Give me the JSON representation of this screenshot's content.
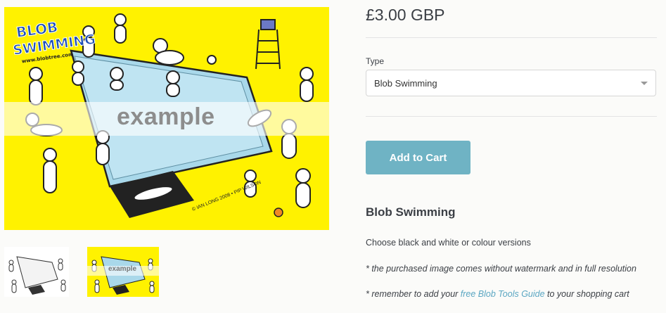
{
  "product": {
    "price": "£3.00 GBP",
    "type_label": "Type",
    "type_selected": "Blob Swimming",
    "add_to_cart": "Add to Cart",
    "title": "Blob Swimming",
    "description_1": "Choose black and white or colour versions",
    "description_2": "* the purchased image comes without watermark and in full resolution",
    "description_3_prefix": "* remember to add your ",
    "description_3_link": "free Blob Tools Guide",
    "description_3_suffix": " to your shopping cart"
  },
  "image": {
    "watermark": "example",
    "logo_line1": "BLOB",
    "logo_line2": "SWIMMING",
    "logo_url": "www.blobtree.com",
    "signature": "© IAN LONG 2008 • PIP WILSON",
    "thumb_watermark": "example"
  },
  "colors": {
    "image_background": "#fff200",
    "pool_water": "#a9d8ea",
    "button": "#6fb3c4",
    "link": "#5aa6c2"
  }
}
